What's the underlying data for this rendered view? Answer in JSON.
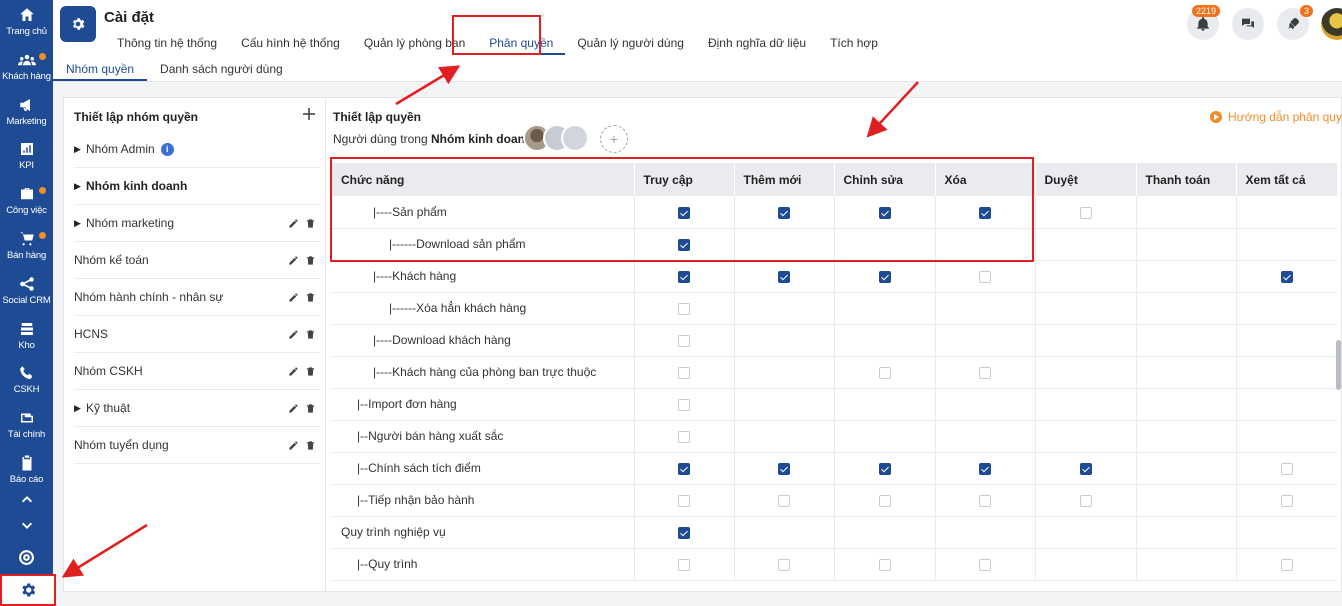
{
  "sidebar": {
    "items": [
      {
        "label": "Trang chủ",
        "icon": "home-icon",
        "dot": false
      },
      {
        "label": "Khách hàng",
        "icon": "users-icon",
        "dot": true
      },
      {
        "label": "Marketing",
        "icon": "megaphone-icon",
        "dot": false
      },
      {
        "label": "KPI",
        "icon": "bar-chart-icon",
        "dot": false
      },
      {
        "label": "Công việc",
        "icon": "briefcase-icon",
        "dot": true
      },
      {
        "label": "Bán hàng",
        "icon": "cart-icon",
        "dot": true
      },
      {
        "label": "Social CRM",
        "icon": "share-icon",
        "dot": false
      },
      {
        "label": "Kho",
        "icon": "warehouse-icon",
        "dot": false
      },
      {
        "label": "CSKH",
        "icon": "phone-icon",
        "dot": false
      },
      {
        "label": "Tài chính",
        "icon": "wallet-icon",
        "dot": false
      },
      {
        "label": "Báo cáo",
        "icon": "clipboard-icon",
        "dot": false
      }
    ]
  },
  "header": {
    "title": "Cài đặt",
    "tabs": [
      "Thông tin hệ thống",
      "Cấu hình hệ thống",
      "Quản lý phòng ban",
      "Phân quyền",
      "Quản lý người dùng",
      "Định nghĩa dữ liệu",
      "Tích hợp"
    ],
    "active_tab": "Phân quyền",
    "notification_count": "2219",
    "rocket_count": "3"
  },
  "subtabs": [
    "Nhóm quyền",
    "Danh sách người dùng"
  ],
  "left_panel": {
    "title": "Thiết lập nhóm quyền",
    "groups": [
      {
        "name": "Nhóm Admin",
        "caret": true,
        "bold": false,
        "info": true,
        "actions": false
      },
      {
        "name": "Nhóm kinh doanh",
        "caret": true,
        "bold": true,
        "info": false,
        "actions": false
      },
      {
        "name": "Nhóm marketing",
        "caret": true,
        "bold": false,
        "info": false,
        "actions": true
      },
      {
        "name": "Nhóm kế toán",
        "caret": false,
        "bold": false,
        "info": false,
        "actions": true
      },
      {
        "name": "Nhóm hành chính - nhân sự",
        "caret": false,
        "bold": false,
        "info": false,
        "actions": true
      },
      {
        "name": "HCNS",
        "caret": false,
        "bold": false,
        "info": false,
        "actions": true
      },
      {
        "name": "Nhóm CSKH",
        "caret": false,
        "bold": false,
        "info": false,
        "actions": true
      },
      {
        "name": "Kỹ thuật",
        "caret": true,
        "bold": false,
        "info": false,
        "actions": true
      },
      {
        "name": "Nhóm tuyển dụng",
        "caret": false,
        "bold": false,
        "info": false,
        "actions": true
      }
    ]
  },
  "right_panel": {
    "title": "Thiết lập quyền",
    "users_prefix": "Người dùng trong",
    "users_group": "Nhóm kinh doanh:",
    "guide_link": "Hướng dẫn phân quyền",
    "columns": [
      "Chức năng",
      "Truy cập",
      "Thêm mới",
      "Chỉnh sửa",
      "Xóa",
      "Duyệt",
      "Thanh toán",
      "Xem tất cả"
    ],
    "rows": [
      {
        "name": "|----Sản phẩm",
        "indent": 32,
        "cells": [
          "on",
          "on",
          "on",
          "on",
          "off",
          "",
          ""
        ]
      },
      {
        "name": "|------Download sản phẩm",
        "indent": 48,
        "cells": [
          "on",
          "",
          "",
          "",
          "",
          "",
          ""
        ]
      },
      {
        "name": "|----Khách hàng",
        "indent": 32,
        "cells": [
          "on",
          "on",
          "on",
          "off",
          "",
          "",
          "on"
        ]
      },
      {
        "name": "|------Xóa hẳn khách hàng",
        "indent": 48,
        "cells": [
          "off",
          "",
          "",
          "",
          "",
          "",
          ""
        ]
      },
      {
        "name": "|----Download khách hàng",
        "indent": 32,
        "cells": [
          "off",
          "",
          "",
          "",
          "",
          "",
          ""
        ]
      },
      {
        "name": "|----Khách hàng của phòng ban trực thuộc",
        "indent": 32,
        "cells": [
          "off",
          "",
          "off",
          "off",
          "",
          "",
          ""
        ]
      },
      {
        "name": "|--Import đơn hàng",
        "indent": 16,
        "cells": [
          "off",
          "",
          "",
          "",
          "",
          "",
          ""
        ]
      },
      {
        "name": "|--Người bán hàng xuất sắc",
        "indent": 16,
        "cells": [
          "off",
          "",
          "",
          "",
          "",
          "",
          ""
        ]
      },
      {
        "name": "|--Chính sách tích điểm",
        "indent": 16,
        "cells": [
          "on",
          "on",
          "on",
          "on",
          "on",
          "",
          "off"
        ]
      },
      {
        "name": "|--Tiếp nhận bảo hành",
        "indent": 16,
        "cells": [
          "off",
          "off",
          "off",
          "off",
          "off",
          "",
          "off"
        ]
      },
      {
        "name": "Quy trình nghiệp vụ",
        "indent": 0,
        "cells": [
          "on",
          "",
          "",
          "",
          "",
          "",
          ""
        ]
      },
      {
        "name": "|--Quy trình",
        "indent": 16,
        "cells": [
          "off",
          "off",
          "off",
          "off",
          "",
          "",
          "off"
        ]
      }
    ]
  }
}
